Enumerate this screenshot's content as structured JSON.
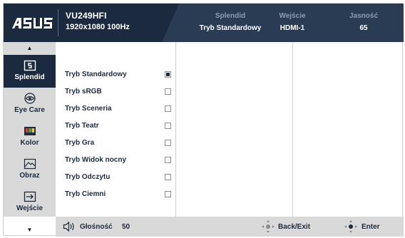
{
  "brand": {
    "logo_text": "ASUS"
  },
  "header": {
    "model": "VU249HFI",
    "resolution": "1920x1080 100Hz",
    "status": [
      {
        "label": "Splendid",
        "value": "Tryb Standardowy"
      },
      {
        "label": "Wejście",
        "value": "HDMI-1"
      },
      {
        "label": "Jasność",
        "value": "65"
      }
    ]
  },
  "nav": {
    "up_arrow": "▲",
    "down_arrow": "▼",
    "items": [
      {
        "label": "Splendid",
        "icon": "splendid-icon"
      },
      {
        "label": "Eye Care",
        "icon": "eye-icon"
      },
      {
        "label": "Kolor",
        "icon": "color-bars-icon"
      },
      {
        "label": "Obraz",
        "icon": "image-icon"
      },
      {
        "label": "Wejście",
        "icon": "input-arrow-icon"
      }
    ]
  },
  "menu": {
    "options": [
      {
        "label": "Tryb Standardowy",
        "selected": true
      },
      {
        "label": "Tryb sRGB",
        "selected": false
      },
      {
        "label": "Tryb Sceneria",
        "selected": false
      },
      {
        "label": "Tryb Teatr",
        "selected": false
      },
      {
        "label": "Tryb Gra",
        "selected": false
      },
      {
        "label": "Tryb Widok nocny",
        "selected": false
      },
      {
        "label": "Tryb Odczytu",
        "selected": false
      },
      {
        "label": "Tryb Ciemni",
        "selected": false
      }
    ]
  },
  "footer": {
    "volume_label": "Głośność",
    "volume_value": "50",
    "back_label": "Back/Exit",
    "enter_label": "Enter"
  },
  "colors": {
    "header_bg": "#1b2a3e",
    "active_bg": "#1b2a3e",
    "panel_gray": "#d9d9d9"
  }
}
